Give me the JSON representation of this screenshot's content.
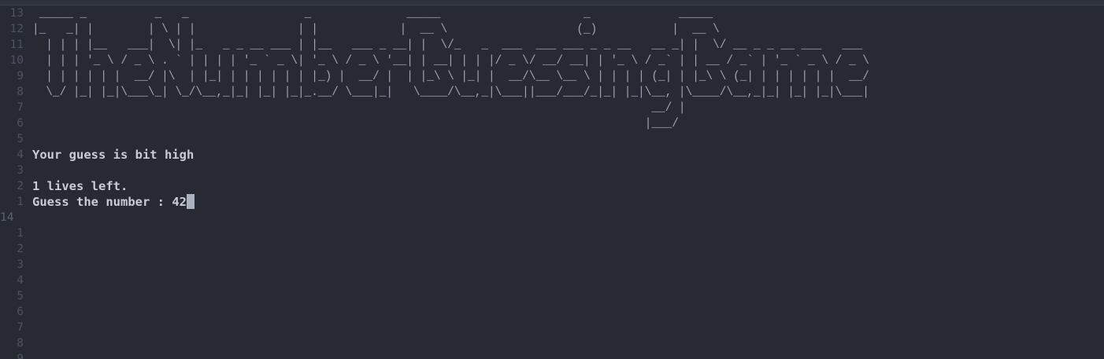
{
  "line_numbers": [
    "13",
    "12",
    "11",
    "10",
    "9",
    "8",
    "7",
    "6",
    "5",
    "4",
    "3",
    "2",
    "1",
    "14",
    "1",
    "2",
    "3",
    "4",
    "5",
    "6",
    "7",
    "8",
    "9"
  ],
  "banner": {
    "art_lines": [
      " _____ _          _   _                 _              _____                     _             _____                      ",
      "|_   _| |        | \\ | |               | |            |  __ \\                   (_)           |  __ \\                     ",
      "  | | | |__   ___|  \\| |_   _ _ __ ___ | |__   ___ _ __| |  \\/_   _  ___  ___ ___ _ _ __   __ _| |  \\/ __ _ _ __ ___   ___ ",
      "  | | | '_ \\ / _ \\ . ` | | | | '_ ` _ \\| '_ \\ / _ \\ '__| | __| | | |/ _ \\/ __/ __| | '_ \\ / _` | | __ / _` | '_ ` _ \\ / _ \\",
      "  | | | | | |  __/ |\\  | |_| | | | | | | |_) |  __/ |  | |_\\ \\ |_| |  __/\\__ \\__ \\ | | | | (_| | |_\\ \\ (_| | | | | | |  __/",
      "  \\_/ |_| |_|\\___\\_| \\_/\\__,_|_| |_| |_|_.__/ \\___|_|   \\____/\\__,_|\\___||___/___/_|_| |_|\\__, |\\____/\\__,_|_| |_| |_|\\___|",
      "                                                                                           __/ |                           ",
      "                                                                                          |___/                            "
    ],
    "dots_lines": [
      "    ¦   ¦   ¦   ¦   ¦   ¦   ¦   ¦   ¦   ¦   ¦   ¦   ¦   ¦   ¦   ¦   ¦   ¦   ¦   ¦",
      "    ¦   ¦   ¦   ¦   ¦   ¦   ¦   ¦   ¦   ¦   ¦   ¦   ¦   ¦   ¦   ¦   ¦   ¦   ¦   ¦"
    ]
  },
  "messages": {
    "hint": "Your guess is bit high",
    "lives": "1 lives left.",
    "prompt": "Guess the number : ",
    "input_value": "42"
  }
}
